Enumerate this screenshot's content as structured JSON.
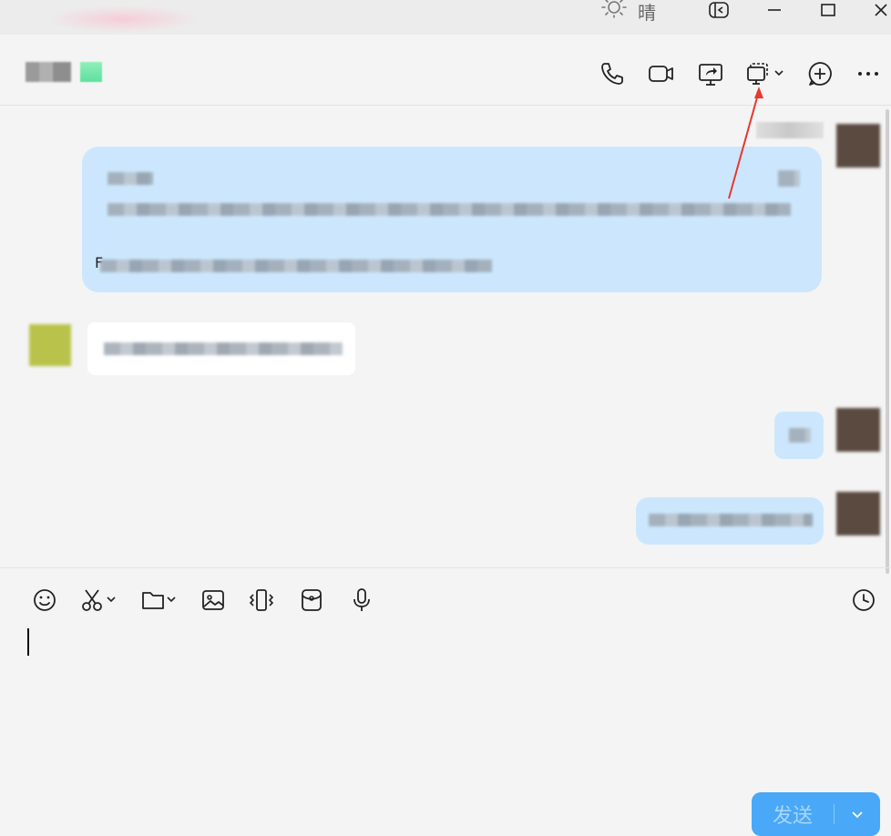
{
  "titlebar": {
    "weather_text": "晴",
    "icons": [
      "sun-icon",
      "sidebar-toggle-icon",
      "minimize-icon",
      "maximize-icon",
      "close-icon"
    ]
  },
  "header": {
    "icons": [
      "phone-icon",
      "video-call-icon",
      "screen-share-icon",
      "remote-assist-icon",
      "add-chat-icon",
      "more-icon"
    ]
  },
  "messages": [
    {
      "side": "right",
      "type": "quote",
      "prefix": "F"
    },
    {
      "side": "left",
      "type": "text"
    },
    {
      "side": "right",
      "type": "text"
    },
    {
      "side": "right",
      "type": "text"
    }
  ],
  "toolbar": {
    "icons": [
      "emoji-icon",
      "scissors-icon",
      "folder-icon",
      "image-icon",
      "shake-icon",
      "red-packet-icon",
      "microphone-icon",
      "history-icon"
    ]
  },
  "send": {
    "label": "发送"
  },
  "colors": {
    "accent": "#49a8f7",
    "bubble_self": "#cce7fd",
    "annotation": "#e8382f"
  }
}
